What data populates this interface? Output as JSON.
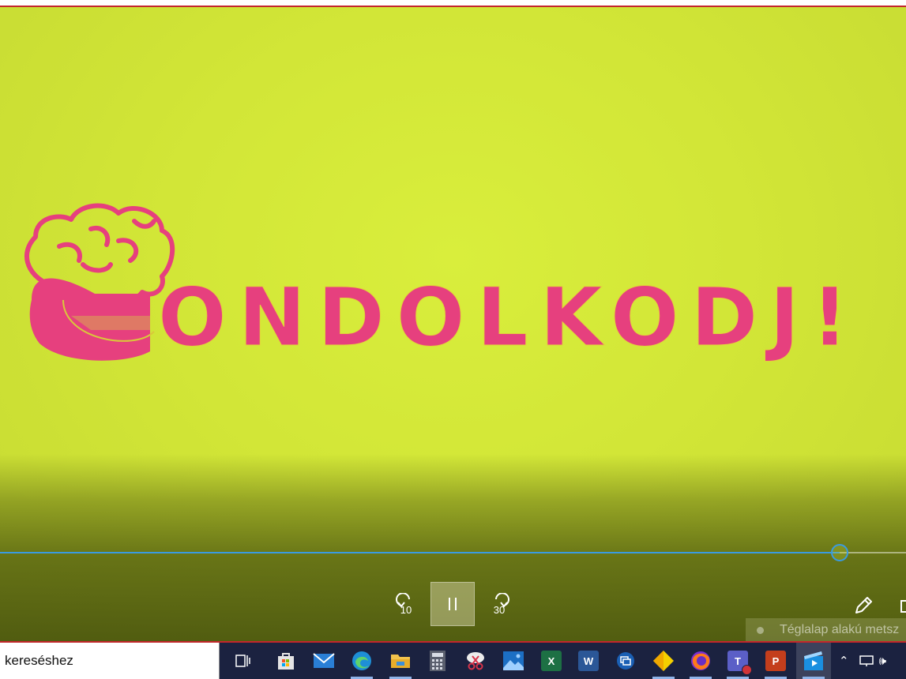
{
  "window": {
    "accent": "#c3272b"
  },
  "video": {
    "logo_text": "ONDOLKODJ!",
    "logo_color": "#e6407e",
    "background_color": "#d6eb3a",
    "progress_fraction": 0.927
  },
  "controls": {
    "skip_back_label": "10",
    "skip_forward_label": "30",
    "play_state": "paused-icon-shown",
    "pen_icon": "pen-icon"
  },
  "tooltip": {
    "text": "Téglalap alakú metsz"
  },
  "taskbar": {
    "search_text": "kereséshez",
    "apps": [
      {
        "name": "task-view-icon"
      },
      {
        "name": "store-icon"
      },
      {
        "name": "mail-icon"
      },
      {
        "name": "edge-icon",
        "active": true
      },
      {
        "name": "file-explorer-icon",
        "active": true
      },
      {
        "name": "calculator-icon"
      },
      {
        "name": "snipping-tool-icon"
      },
      {
        "name": "photos-icon"
      },
      {
        "name": "excel-icon",
        "label": "X"
      },
      {
        "name": "word-icon",
        "label": "W"
      },
      {
        "name": "remote-desktop-icon"
      },
      {
        "name": "diamond-app-icon",
        "active": true
      },
      {
        "name": "firefox-icon",
        "active": true
      },
      {
        "name": "teams-icon",
        "label": "T",
        "active": true
      },
      {
        "name": "powerpoint-icon",
        "label": "P",
        "active": true
      },
      {
        "name": "movies-tv-icon",
        "current": true
      }
    ]
  }
}
